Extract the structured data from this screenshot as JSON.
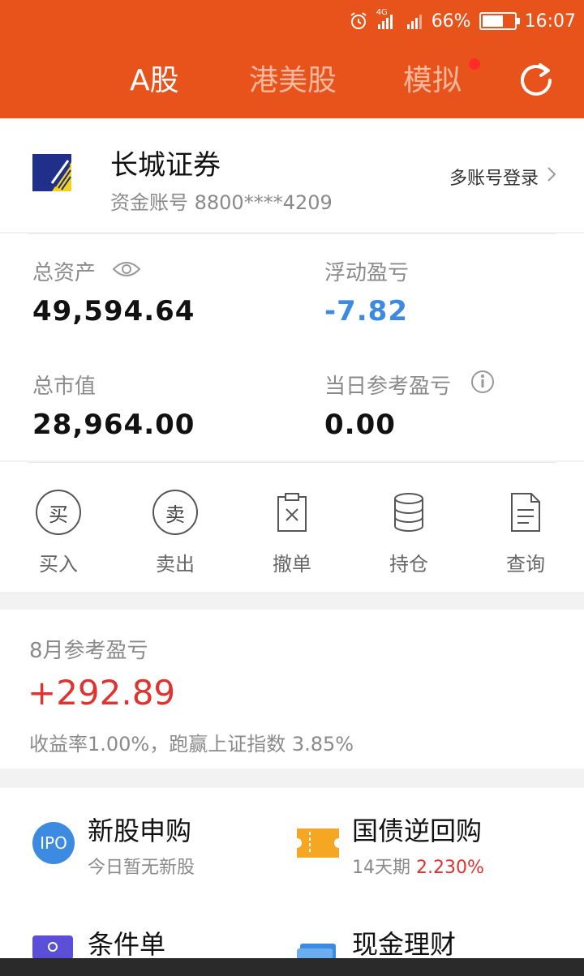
{
  "status_bar": {
    "network": "4G",
    "battery": "66%",
    "battery_level": 0.66,
    "time": "16:07"
  },
  "tabs": [
    {
      "label": "A股",
      "active": true
    },
    {
      "label": "港美股",
      "active": false
    },
    {
      "label": "模拟",
      "active": false,
      "badge": true
    }
  ],
  "account": {
    "broker": "长城证券",
    "account_number": "资金账号 8800****4209",
    "multi_login": "多账号登录"
  },
  "assets": {
    "total_assets_label": "总资产",
    "total_assets": "49,594.64",
    "floating_pl_label": "浮动盈亏",
    "floating_pl": "-7.82",
    "market_value_label": "总市值",
    "market_value": "28,964.00",
    "daily_pl_label": "当日参考盈亏",
    "daily_pl": "0.00"
  },
  "actions": [
    {
      "label": "买入",
      "glyph": "买",
      "icon": "buy-icon"
    },
    {
      "label": "卖出",
      "glyph": "卖",
      "icon": "sell-icon"
    },
    {
      "label": "撤单",
      "icon": "cancel-order-icon"
    },
    {
      "label": "持仓",
      "icon": "holdings-icon"
    },
    {
      "label": "查询",
      "icon": "query-document-icon"
    }
  ],
  "monthly": {
    "title": "8月参考盈亏",
    "value": "+292.89",
    "description": "收益率1.00%，跑赢上证指数 3.85%"
  },
  "services": {
    "ipo_badge": "IPO",
    "ipo_title": "新股申购",
    "ipo_sub": "今日暂无新股",
    "repo_title": "国债逆回购",
    "repo_sub_prefix": "14天期 ",
    "repo_rate": "2.230%",
    "conditional_title": "条件单",
    "cash_title": "现金理财"
  },
  "colors": {
    "brand": "#e8531c",
    "gain": "#e0322f",
    "loss": "#3d8be0"
  }
}
